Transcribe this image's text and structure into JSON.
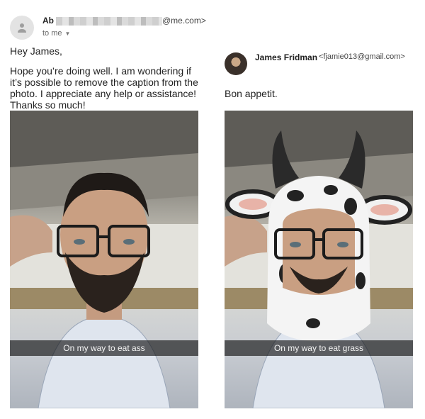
{
  "email": {
    "sender_name": "Ab",
    "sender_domain": "@me.com>",
    "to_label": "to me",
    "greeting": "Hey James,",
    "body": "Hope you’re doing well. I am wondering if\nit’s possible to remove the caption from the\nphoto. I appreciate any help or assistance!\nThanks so much!"
  },
  "reply": {
    "name": "James Fridman",
    "email": "<fjamie013@gmail.com>",
    "text": "Bon appetit."
  },
  "photos": {
    "left_caption": "On my way to eat ass",
    "right_caption": "On my way to eat grass"
  }
}
